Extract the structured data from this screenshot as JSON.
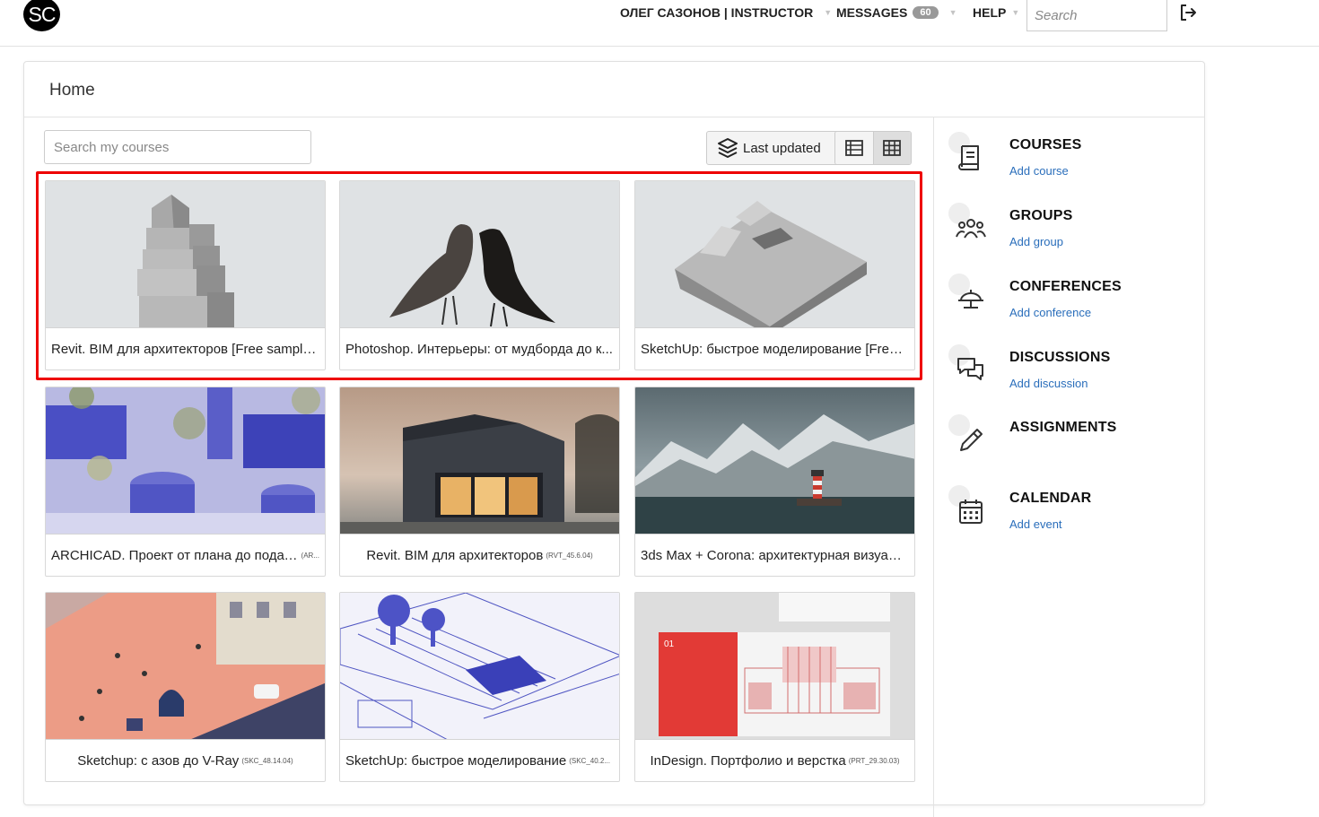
{
  "header": {
    "logo_text": "SC",
    "user": "ОЛЕГ САЗОНОВ | INSTRUCTOR",
    "messages_label": "MESSAGES",
    "messages_count": "60",
    "help_label": "HELP",
    "search_placeholder": "Search"
  },
  "page": {
    "title": "Home",
    "search_courses_placeholder": "Search my courses",
    "sort_label": "Last updated"
  },
  "courses": [
    {
      "title": "Revit. BIM для архитекторов [Free sample]...",
      "code": ""
    },
    {
      "title": "Photoshop. Интерьеры: от мудборда до к...",
      "code": ""
    },
    {
      "title": "SketchUp: быстрое моделирование [Free ...",
      "code": ""
    },
    {
      "title": "ARCHICAD. Проект от плана до подачи",
      "code": "(AR..."
    },
    {
      "title": "Revit. BIM для архитекторов",
      "code": "(RVT_45.6.04)"
    },
    {
      "title": "3ds Max + Corona: архитектурная визуали...",
      "code": ""
    },
    {
      "title": "Sketchup: с азов до V-Ray",
      "code": "(SKC_48.14.04)"
    },
    {
      "title": "SketchUp: быстрое моделирование",
      "code": "(SKC_40.2..."
    },
    {
      "title": "InDesign. Портфолио и верстка",
      "code": "(PRT_29.30.03)"
    }
  ],
  "sidebar": [
    {
      "label": "COURSES",
      "link": "Add course",
      "icon": "book-icon"
    },
    {
      "label": "GROUPS",
      "link": "Add group",
      "icon": "people-icon"
    },
    {
      "label": "CONFERENCES",
      "link": "Add conference",
      "icon": "presentation-icon"
    },
    {
      "label": "DISCUSSIONS",
      "link": "Add discussion",
      "icon": "chat-bubbles-icon"
    },
    {
      "label": "ASSIGNMENTS",
      "link": "",
      "icon": "pencil-icon"
    },
    {
      "label": "CALENDAR",
      "link": "Add event",
      "icon": "calendar-icon"
    }
  ],
  "colors": {
    "accent_link": "#2a6ebb",
    "highlight": "#ee0000",
    "badge": "#999999"
  }
}
